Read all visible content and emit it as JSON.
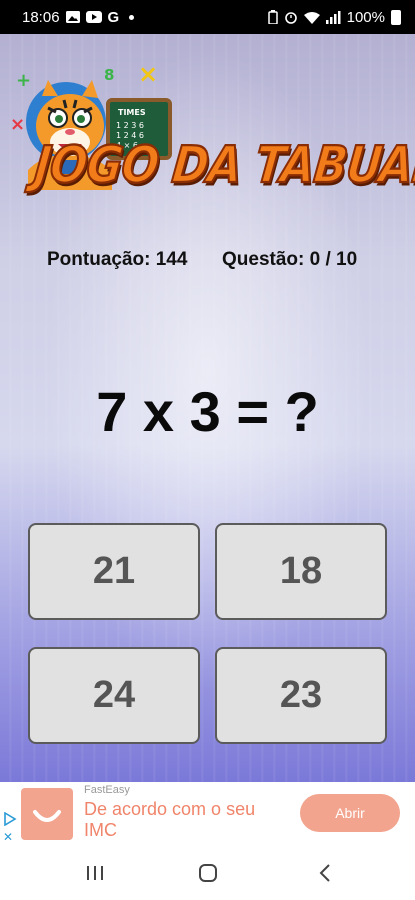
{
  "status_bar": {
    "time": "18:06",
    "left_icons": [
      "gallery-icon",
      "youtube-icon",
      "google-icon"
    ],
    "right_icons": [
      "battery-saver-icon",
      "alarm-icon",
      "wifi-icon",
      "signal-icon"
    ],
    "battery": "100%"
  },
  "game": {
    "logo_text": "JOGO DA TABUADA",
    "logo_board_text": "TIMES",
    "score_label": "Pontuação: 144",
    "question_counter": "Questão:  0 / 10",
    "question": "7 x 3 = ?",
    "answers": [
      "21",
      "18",
      "24",
      "23"
    ]
  },
  "ad": {
    "brand": "FastEasy",
    "text": "De acordo com o seu IMC",
    "button": "Abrir",
    "accent_color": "#f2a48e"
  },
  "colors": {
    "background_top": "#b3b0d2",
    "background_bottom": "#7b79d8",
    "logo_orange": "#f37c1a"
  }
}
